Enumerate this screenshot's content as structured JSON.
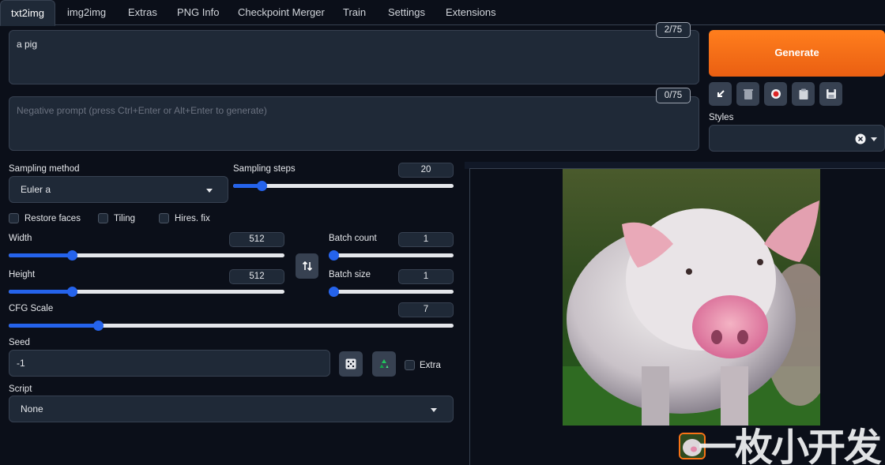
{
  "tabs": [
    {
      "label": "txt2img",
      "active": true
    },
    {
      "label": "img2img"
    },
    {
      "label": "Extras"
    },
    {
      "label": "PNG Info"
    },
    {
      "label": "Checkpoint Merger"
    },
    {
      "label": "Train"
    },
    {
      "label": "Settings"
    },
    {
      "label": "Extensions"
    }
  ],
  "prompt": {
    "value": "a pig",
    "counter": "2/75"
  },
  "negative_prompt": {
    "placeholder": "Negative prompt (press Ctrl+Enter or Alt+Enter to generate)",
    "counter": "0/75"
  },
  "generate_label": "Generate",
  "toolbar_icons": [
    "arrow-down-left-icon",
    "trash-icon",
    "record-icon",
    "clipboard-icon",
    "save-icon"
  ],
  "styles": {
    "label": "Styles"
  },
  "sampling_method": {
    "label": "Sampling method",
    "value": "Euler a"
  },
  "sampling_steps": {
    "label": "Sampling steps",
    "value": "20",
    "fraction": 0.13
  },
  "checkboxes": {
    "restore_faces": "Restore faces",
    "tiling": "Tiling",
    "hires_fix": "Hires. fix"
  },
  "width": {
    "label": "Width",
    "value": "512",
    "fraction": 0.23
  },
  "height": {
    "label": "Height",
    "value": "512",
    "fraction": 0.23
  },
  "batch_count": {
    "label": "Batch count",
    "value": "1",
    "fraction": 0.0
  },
  "batch_size": {
    "label": "Batch size",
    "value": "1",
    "fraction": 0.0
  },
  "cfg_scale": {
    "label": "CFG Scale",
    "value": "7",
    "fraction": 0.2
  },
  "seed": {
    "label": "Seed",
    "value": "-1",
    "extra_label": "Extra"
  },
  "script": {
    "label": "Script",
    "value": "None"
  },
  "colors": {
    "accent": "#ea6a14",
    "slider": "#2563eb",
    "background": "#0b0f19",
    "panel": "#1f2937"
  },
  "watermark": "一枚小开发"
}
